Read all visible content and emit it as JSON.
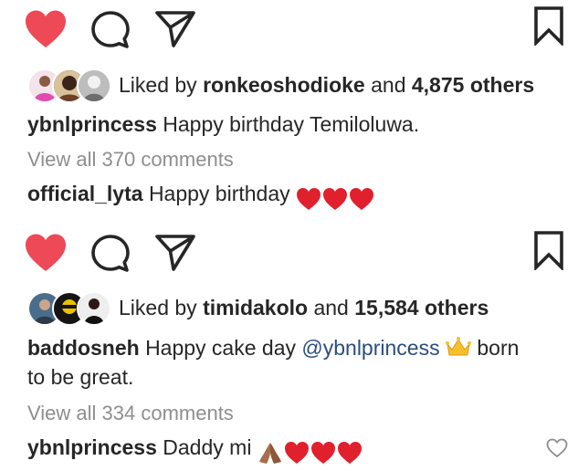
{
  "colors": {
    "like_red": "#ed4956",
    "icon_dark": "#262626",
    "muted_gray": "#8e8e8e",
    "mention_blue": "#2b4d7e",
    "emoji_red": "#e0202c"
  },
  "icons": {
    "like": "heart-filled-icon",
    "comment": "comment-bubble-icon",
    "share": "paper-plane-icon",
    "save": "bookmark-icon",
    "comment_like": "heart-outline-icon"
  },
  "posts": [
    {
      "liked": true,
      "liked_by_prefix": "Liked by",
      "liked_by_user": "ronkeoshodioke",
      "liked_by_and": "and",
      "liked_by_count": "4,875 others",
      "caption_user": "ybnlprincess",
      "caption_text": "Happy birthday Temiloluwa.",
      "view_comments": "View all 370 comments",
      "comment_user": "official_lyta",
      "comment_text": "Happy birthday",
      "comment_emojis": [
        "red-heart",
        "red-heart",
        "red-heart"
      ]
    },
    {
      "liked": true,
      "liked_by_prefix": "Liked by",
      "liked_by_user": "timidakolo",
      "liked_by_and": "and",
      "liked_by_count": "15,584 others",
      "caption_user": "baddosneh",
      "caption_text": "Happy cake day",
      "caption_mention": "@ybnlprincess",
      "caption_emoji": "crown",
      "caption_text_after": "born",
      "caption_line2": "to be great.",
      "view_comments": "View all 334 comments",
      "comment_user": "ybnlprincess",
      "comment_text": "Daddy mi",
      "comment_emojis": [
        "folded-hands",
        "red-heart",
        "red-heart",
        "red-heart"
      ]
    }
  ]
}
